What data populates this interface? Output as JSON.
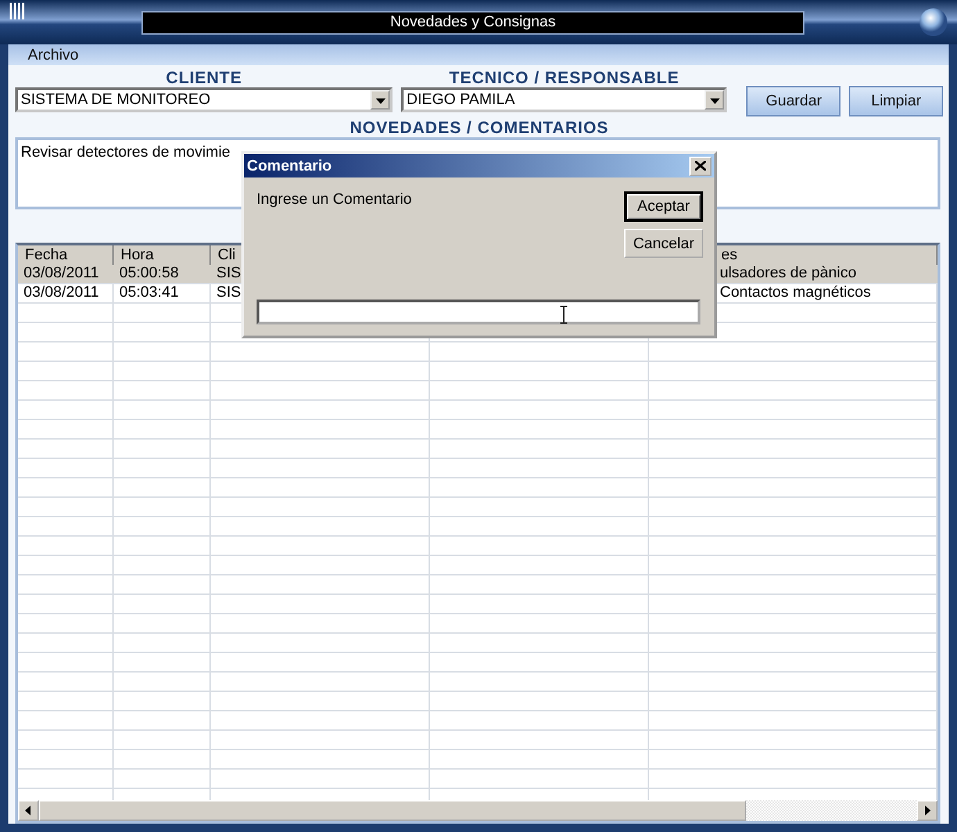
{
  "window": {
    "title": "Novedades y Consignas"
  },
  "menu": [
    "Archivo"
  ],
  "cliente": {
    "label": "CLIENTE",
    "value": "SISTEMA DE MONITOREO"
  },
  "tecnico": {
    "label": "TECNICO / RESPONSABLE",
    "value": "DIEGO PAMILA"
  },
  "buttons": [
    "Guardar",
    "Limpiar"
  ],
  "novedades": {
    "label": "NOVEDADES / COMENTARIOS",
    "value": "Revisar detectores de movimie"
  },
  "table": {
    "columns": [
      "Fecha",
      "Hora",
      "Cli",
      "",
      "es"
    ],
    "rows": [
      {
        "selected": true,
        "cells": [
          "03/08/2011",
          "05:00:58",
          "SIS",
          "",
          "ulsadores de pànico"
        ]
      },
      {
        "selected": false,
        "cells": [
          "03/08/2011",
          "05:03:41",
          "SIS",
          "",
          "Contactos magnéticos"
        ]
      }
    ]
  },
  "dialog": {
    "title": "Comentario",
    "prompt": "Ingrese un Comentario",
    "buttons": [
      {
        "label": "Aceptar",
        "default": true
      },
      {
        "label": "Cancelar",
        "default": false
      }
    ]
  }
}
